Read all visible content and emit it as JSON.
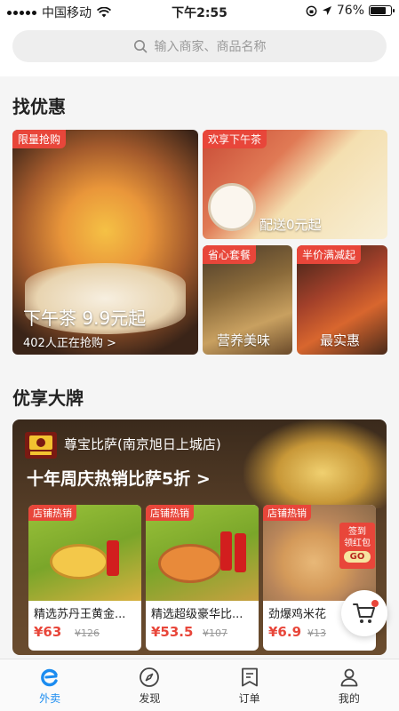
{
  "status_bar": {
    "carrier": "中国移动",
    "time": "下午2:55",
    "battery": "76%",
    "battery_level": 0.76
  },
  "search": {
    "placeholder": "输入商家、商品名称"
  },
  "deals": {
    "title": "找优惠",
    "main_card": {
      "tag": "限量抢购",
      "headline": "下午茶 9.9元起",
      "subline": "402人正在抢购 >"
    },
    "top_right_card": {
      "tag": "欢享下午茶",
      "text": "配送0元起"
    },
    "bottom_left_card": {
      "tag": "省心套餐",
      "text": "营养美味"
    },
    "bottom_right_card": {
      "tag": "半价满减起",
      "text": "最实惠"
    }
  },
  "brands": {
    "title": "优享大牌",
    "store_name": "尊宝比萨(南京旭日上城店)",
    "promo": "十年周庆热销比萨5折 >",
    "sign_badge": {
      "line1": "签到",
      "line2": "领红包",
      "button": "GO"
    },
    "products": [
      {
        "tag": "店铺热销",
        "name": "精选苏丹王黄金...",
        "price": "¥63",
        "old_price": "¥126"
      },
      {
        "tag": "店铺热销",
        "name": "精选超级豪华比...",
        "price": "¥53.5",
        "old_price": "¥107"
      },
      {
        "tag": "店铺热销",
        "name": "劲爆鸡米花",
        "price": "¥6.9",
        "old_price": "¥13"
      }
    ]
  },
  "tab_bar": {
    "tabs": [
      {
        "label": "外卖",
        "icon": "takeout-e-icon",
        "active": true
      },
      {
        "label": "发现",
        "icon": "compass-icon",
        "active": false
      },
      {
        "label": "订单",
        "icon": "order-list-icon",
        "active": false
      },
      {
        "label": "我的",
        "icon": "user-icon",
        "active": false
      }
    ]
  },
  "colors": {
    "accent_red": "#e8463a",
    "active_blue": "#1b8cf0"
  }
}
